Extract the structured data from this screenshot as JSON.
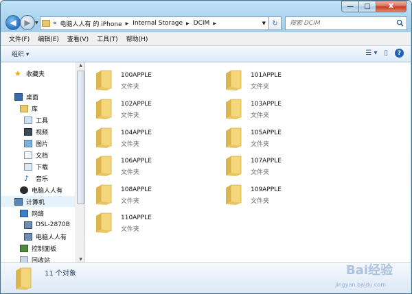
{
  "window": {
    "caption_buttons": {
      "minimize": "—",
      "maximize": "□",
      "close": "X"
    }
  },
  "navigation": {
    "back_icon": "back-arrow-icon",
    "forward_icon": "forward-arrow-icon",
    "breadcrumb": [
      "«",
      "电脑人人有 的 iPhone",
      "Internal Storage",
      "DCIM"
    ],
    "refresh_icon": "refresh-icon"
  },
  "search": {
    "placeholder": "搜索 DCIM"
  },
  "menubar": {
    "items": [
      "文件(F)",
      "编辑(E)",
      "查看(V)",
      "工具(T)",
      "帮助(H)"
    ]
  },
  "commandbar": {
    "organize_label": "组织 ▾",
    "view_icon": "change-view-icon",
    "preview_icon": "preview-pane-icon",
    "help_icon": "help-icon",
    "help_glyph": "?"
  },
  "navpane": {
    "items": [
      {
        "label": "收藏夹",
        "icon": "star-icon"
      },
      {
        "label": "桌面",
        "icon": "desktop-icon"
      },
      {
        "label": "库",
        "icon": "library-icon"
      },
      {
        "label": "工具",
        "icon": "tools-library-icon"
      },
      {
        "label": "视频",
        "icon": "video-icon"
      },
      {
        "label": "图片",
        "icon": "pictures-icon"
      },
      {
        "label": "文档",
        "icon": "documents-icon"
      },
      {
        "label": "下载",
        "icon": "download-icon"
      },
      {
        "label": "音乐",
        "icon": "music-icon"
      },
      {
        "label": "电脑人人有",
        "icon": "user-icon"
      },
      {
        "label": "计算机",
        "icon": "computer-icon"
      },
      {
        "label": "网络",
        "icon": "network-icon"
      },
      {
        "label": "DSL-2870B",
        "icon": "network-computer-icon"
      },
      {
        "label": "电脑人人有",
        "icon": "network-computer-icon"
      },
      {
        "label": "控制面板",
        "icon": "control-panel-icon"
      },
      {
        "label": "回收站",
        "icon": "recycle-bin-icon"
      }
    ]
  },
  "folders": [
    {
      "name": "100APPLE",
      "type": "文件夹"
    },
    {
      "name": "101APPLE",
      "type": "文件夹"
    },
    {
      "name": "102APPLE",
      "type": "文件夹"
    },
    {
      "name": "103APPLE",
      "type": "文件夹"
    },
    {
      "name": "104APPLE",
      "type": "文件夹"
    },
    {
      "name": "105APPLE",
      "type": "文件夹"
    },
    {
      "name": "106APPLE",
      "type": "文件夹"
    },
    {
      "name": "107APPLE",
      "type": "文件夹"
    },
    {
      "name": "108APPLE",
      "type": "文件夹"
    },
    {
      "name": "109APPLE",
      "type": "文件夹"
    },
    {
      "name": "110APPLE",
      "type": "文件夹"
    }
  ],
  "details": {
    "count_text": "11 个对象"
  },
  "watermark": {
    "text": "Bai经验",
    "sub": "jingyan.baidu.com"
  },
  "colors": {
    "folder_yellow": "#f3d77a",
    "folder_dark": "#dcb54e",
    "selection": "#e5f1fb",
    "accent": "#1e395b"
  }
}
